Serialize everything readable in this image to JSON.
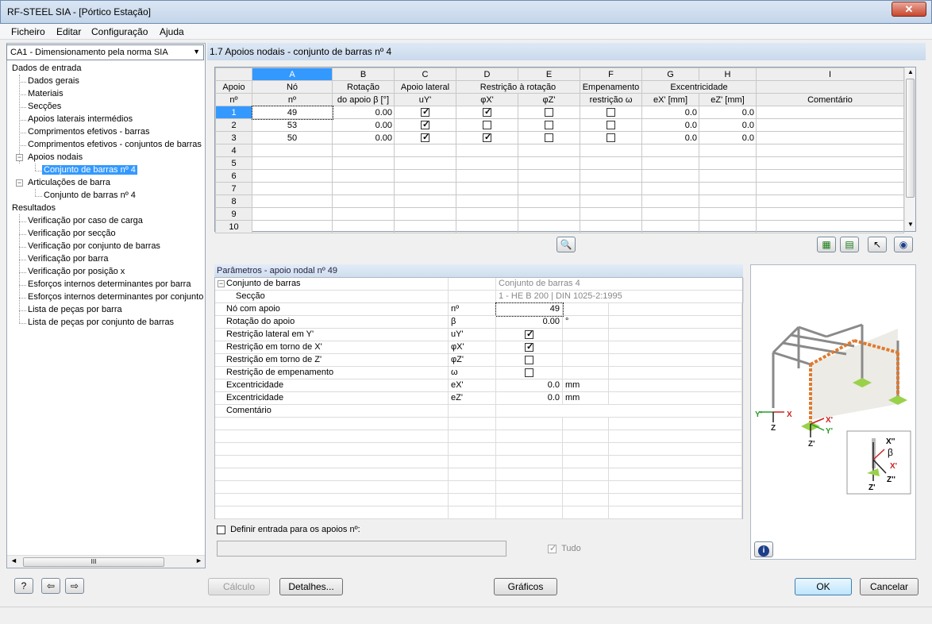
{
  "window": {
    "title": "RF-STEEL SIA - [Pórtico Estação]",
    "close": "✕"
  },
  "menu": [
    "Ficheiro",
    "Editar",
    "Configuração",
    "Ajuda"
  ],
  "case_select": "CA1 - Dimensionamento pela norma SIA",
  "tree": {
    "input_root": "Dados de entrada",
    "input_items": [
      "Dados gerais",
      "Materiais",
      "Secções",
      "Apoios laterais intermédios",
      "Comprimentos efetivos - barras",
      "Comprimentos efetivos - conjuntos de barras",
      "Apoios nodais"
    ],
    "apoios_child": "Conjunto de barras nº 4",
    "articulacoes": "Articulações de barra",
    "articulacoes_child": "Conjunto de barras nº 4",
    "results_root": "Resultados",
    "results_items": [
      "Verificação por caso de carga",
      "Verificação por secção",
      "Verificação por conjunto de barras",
      "Verificação por barra",
      "Verificação por posição x",
      "Esforços internos determinantes por barra",
      "Esforços internos determinantes por conjunto",
      "Lista de peças por barra",
      "Lista de peças por conjunto de barras"
    ],
    "scroll_mark": "III"
  },
  "section_title": "1.7 Apoios nodais - conjunto de barras nº 4",
  "grid": {
    "col_letters": [
      "A",
      "B",
      "C",
      "D",
      "E",
      "F",
      "G",
      "H",
      "I"
    ],
    "h1": {
      "rowhdr": "Apoio",
      "a": "Nó",
      "b": "Rotação",
      "c": "Apoio lateral",
      "de": "Restrição à rotação",
      "f": "Empenamento",
      "gh": "Excentricidade",
      "i": ""
    },
    "h2": {
      "rowhdr": "nº",
      "a": "nº",
      "b": "do apoio β [°]",
      "c": "uY'",
      "d": "φX'",
      "e": "φZ'",
      "f": "restrição ω",
      "g": "eX' [mm]",
      "h": "eZ' [mm]",
      "i": "Comentário"
    },
    "rows": [
      {
        "n": "1",
        "node": "49",
        "rot": "0.00",
        "uy": true,
        "phix": true,
        "phiz": false,
        "omega": false,
        "ex": "0.0",
        "ez": "0.0"
      },
      {
        "n": "2",
        "node": "53",
        "rot": "0.00",
        "uy": true,
        "phix": false,
        "phiz": false,
        "omega": false,
        "ex": "0.0",
        "ez": "0.0"
      },
      {
        "n": "3",
        "node": "50",
        "rot": "0.00",
        "uy": true,
        "phix": true,
        "phiz": false,
        "omega": false,
        "ex": "0.0",
        "ez": "0.0"
      },
      {
        "n": "4"
      },
      {
        "n": "5"
      },
      {
        "n": "6"
      },
      {
        "n": "7"
      },
      {
        "n": "8"
      },
      {
        "n": "9"
      },
      {
        "n": "10"
      }
    ]
  },
  "params": {
    "title": "Parâmetros - apoio nodal nº 49",
    "rows": [
      {
        "label": "Conjunto de barras",
        "sym": "",
        "val": "Conjunto de barras 4",
        "unit": ""
      },
      {
        "label": "Secção",
        "sym": "",
        "val": "1 - HE B 200 | DIN 1025-2:1995",
        "unit": ""
      },
      {
        "label": "Nó com apoio",
        "sym": "nº",
        "val": "49",
        "unit": ""
      },
      {
        "label": "Rotação do apoio",
        "sym": "β",
        "val": "0.00",
        "unit": "°"
      },
      {
        "label": "Restrição lateral em Y'",
        "sym": "uY'",
        "val": "",
        "unit": ""
      },
      {
        "label": "Restrição em torno de X'",
        "sym": "φX'",
        "val": "",
        "unit": ""
      },
      {
        "label": "Restrição em torno de Z'",
        "sym": "φZ'",
        "val": "",
        "unit": ""
      },
      {
        "label": "Restrição de empenamento",
        "sym": "ω",
        "val": "",
        "unit": ""
      },
      {
        "label": "Excentricidade",
        "sym": "eX'",
        "val": "0.0",
        "unit": "mm"
      },
      {
        "label": "Excentricidade",
        "sym": "eZ'",
        "val": "0.0",
        "unit": "mm"
      },
      {
        "label": "Comentário",
        "sym": "",
        "val": "",
        "unit": ""
      }
    ],
    "define_label": "Definir entrada para os apoios nº:",
    "tudo": "Tudo"
  },
  "preview_labels": {
    "y": "Y'",
    "x": "X",
    "z": "Z",
    "x1": "X'",
    "y1": "Y'",
    "z1": "Z'",
    "x2": "X''",
    "beta": "β",
    "x3": "X'",
    "z2": "Z''",
    "z3": "Z'"
  },
  "buttons": {
    "calculo": "Cálculo",
    "detalhes": "Detalhes...",
    "graficos": "Gráficos",
    "ok": "OK",
    "cancelar": "Cancelar"
  }
}
